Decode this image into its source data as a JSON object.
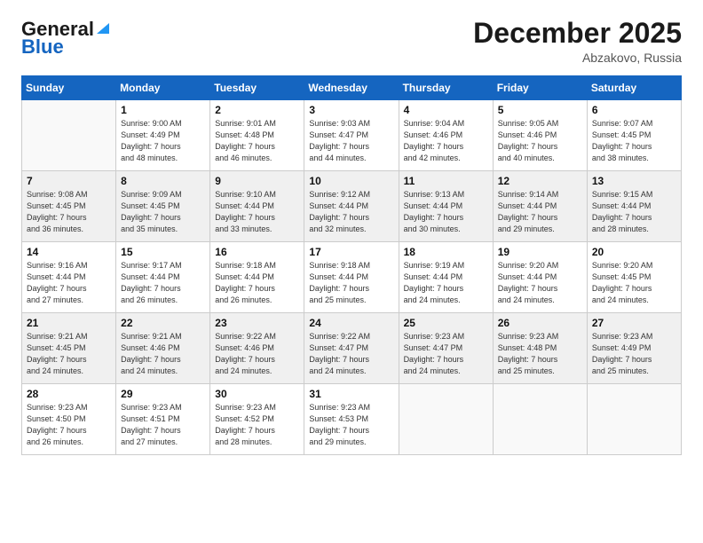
{
  "header": {
    "logo_line1": "General",
    "logo_line2": "Blue",
    "month_title": "December 2025",
    "subtitle": "Abzakovo, Russia"
  },
  "weekdays": [
    "Sunday",
    "Monday",
    "Tuesday",
    "Wednesday",
    "Thursday",
    "Friday",
    "Saturday"
  ],
  "weeks": [
    [
      {
        "day": "",
        "info": ""
      },
      {
        "day": "1",
        "info": "Sunrise: 9:00 AM\nSunset: 4:49 PM\nDaylight: 7 hours\nand 48 minutes."
      },
      {
        "day": "2",
        "info": "Sunrise: 9:01 AM\nSunset: 4:48 PM\nDaylight: 7 hours\nand 46 minutes."
      },
      {
        "day": "3",
        "info": "Sunrise: 9:03 AM\nSunset: 4:47 PM\nDaylight: 7 hours\nand 44 minutes."
      },
      {
        "day": "4",
        "info": "Sunrise: 9:04 AM\nSunset: 4:46 PM\nDaylight: 7 hours\nand 42 minutes."
      },
      {
        "day": "5",
        "info": "Sunrise: 9:05 AM\nSunset: 4:46 PM\nDaylight: 7 hours\nand 40 minutes."
      },
      {
        "day": "6",
        "info": "Sunrise: 9:07 AM\nSunset: 4:45 PM\nDaylight: 7 hours\nand 38 minutes."
      }
    ],
    [
      {
        "day": "7",
        "info": "Sunrise: 9:08 AM\nSunset: 4:45 PM\nDaylight: 7 hours\nand 36 minutes."
      },
      {
        "day": "8",
        "info": "Sunrise: 9:09 AM\nSunset: 4:45 PM\nDaylight: 7 hours\nand 35 minutes."
      },
      {
        "day": "9",
        "info": "Sunrise: 9:10 AM\nSunset: 4:44 PM\nDaylight: 7 hours\nand 33 minutes."
      },
      {
        "day": "10",
        "info": "Sunrise: 9:12 AM\nSunset: 4:44 PM\nDaylight: 7 hours\nand 32 minutes."
      },
      {
        "day": "11",
        "info": "Sunrise: 9:13 AM\nSunset: 4:44 PM\nDaylight: 7 hours\nand 30 minutes."
      },
      {
        "day": "12",
        "info": "Sunrise: 9:14 AM\nSunset: 4:44 PM\nDaylight: 7 hours\nand 29 minutes."
      },
      {
        "day": "13",
        "info": "Sunrise: 9:15 AM\nSunset: 4:44 PM\nDaylight: 7 hours\nand 28 minutes."
      }
    ],
    [
      {
        "day": "14",
        "info": "Sunrise: 9:16 AM\nSunset: 4:44 PM\nDaylight: 7 hours\nand 27 minutes."
      },
      {
        "day": "15",
        "info": "Sunrise: 9:17 AM\nSunset: 4:44 PM\nDaylight: 7 hours\nand 26 minutes."
      },
      {
        "day": "16",
        "info": "Sunrise: 9:18 AM\nSunset: 4:44 PM\nDaylight: 7 hours\nand 26 minutes."
      },
      {
        "day": "17",
        "info": "Sunrise: 9:18 AM\nSunset: 4:44 PM\nDaylight: 7 hours\nand 25 minutes."
      },
      {
        "day": "18",
        "info": "Sunrise: 9:19 AM\nSunset: 4:44 PM\nDaylight: 7 hours\nand 24 minutes."
      },
      {
        "day": "19",
        "info": "Sunrise: 9:20 AM\nSunset: 4:44 PM\nDaylight: 7 hours\nand 24 minutes."
      },
      {
        "day": "20",
        "info": "Sunrise: 9:20 AM\nSunset: 4:45 PM\nDaylight: 7 hours\nand 24 minutes."
      }
    ],
    [
      {
        "day": "21",
        "info": "Sunrise: 9:21 AM\nSunset: 4:45 PM\nDaylight: 7 hours\nand 24 minutes."
      },
      {
        "day": "22",
        "info": "Sunrise: 9:21 AM\nSunset: 4:46 PM\nDaylight: 7 hours\nand 24 minutes."
      },
      {
        "day": "23",
        "info": "Sunrise: 9:22 AM\nSunset: 4:46 PM\nDaylight: 7 hours\nand 24 minutes."
      },
      {
        "day": "24",
        "info": "Sunrise: 9:22 AM\nSunset: 4:47 PM\nDaylight: 7 hours\nand 24 minutes."
      },
      {
        "day": "25",
        "info": "Sunrise: 9:23 AM\nSunset: 4:47 PM\nDaylight: 7 hours\nand 24 minutes."
      },
      {
        "day": "26",
        "info": "Sunrise: 9:23 AM\nSunset: 4:48 PM\nDaylight: 7 hours\nand 25 minutes."
      },
      {
        "day": "27",
        "info": "Sunrise: 9:23 AM\nSunset: 4:49 PM\nDaylight: 7 hours\nand 25 minutes."
      }
    ],
    [
      {
        "day": "28",
        "info": "Sunrise: 9:23 AM\nSunset: 4:50 PM\nDaylight: 7 hours\nand 26 minutes."
      },
      {
        "day": "29",
        "info": "Sunrise: 9:23 AM\nSunset: 4:51 PM\nDaylight: 7 hours\nand 27 minutes."
      },
      {
        "day": "30",
        "info": "Sunrise: 9:23 AM\nSunset: 4:52 PM\nDaylight: 7 hours\nand 28 minutes."
      },
      {
        "day": "31",
        "info": "Sunrise: 9:23 AM\nSunset: 4:53 PM\nDaylight: 7 hours\nand 29 minutes."
      },
      {
        "day": "",
        "info": ""
      },
      {
        "day": "",
        "info": ""
      },
      {
        "day": "",
        "info": ""
      }
    ]
  ]
}
